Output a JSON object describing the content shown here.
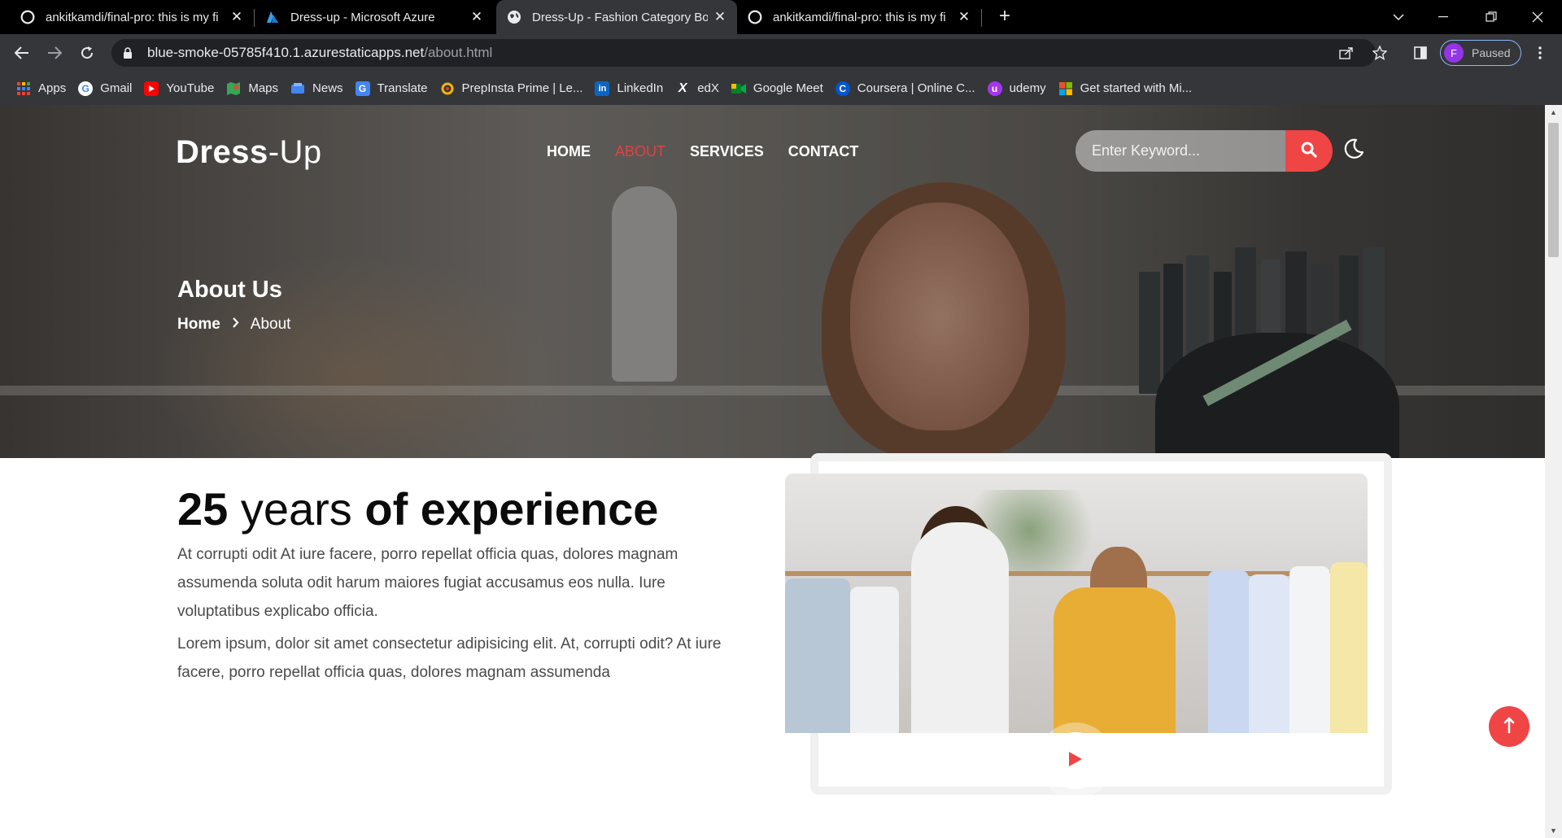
{
  "browser": {
    "tabs": [
      {
        "title": "ankitkamdi/final-pro: this is my fi",
        "active": false
      },
      {
        "title": "Dress-up - Microsoft Azure",
        "active": false
      },
      {
        "title": "Dress-Up - Fashion Category Boo",
        "active": true
      },
      {
        "title": "ankitkamdi/final-pro: this is my fi",
        "active": false
      }
    ],
    "url_host": "blue-smoke-05785f410.1.azurestaticapps.net",
    "url_path": "/about.html",
    "profile_initial": "F",
    "profile_status": "Paused",
    "bookmarks": [
      {
        "label": "Apps",
        "icon": "apps-grid-icon"
      },
      {
        "label": "Gmail",
        "icon": "google-icon"
      },
      {
        "label": "YouTube",
        "icon": "youtube-icon"
      },
      {
        "label": "Maps",
        "icon": "maps-icon"
      },
      {
        "label": "News",
        "icon": "news-icon"
      },
      {
        "label": "Translate",
        "icon": "translate-icon"
      },
      {
        "label": "PrepInsta Prime | Le...",
        "icon": "prepinsta-icon"
      },
      {
        "label": "LinkedIn",
        "icon": "linkedin-icon"
      },
      {
        "label": "edX",
        "icon": "edx-icon"
      },
      {
        "label": "Google Meet",
        "icon": "meet-icon"
      },
      {
        "label": "Coursera | Online C...",
        "icon": "coursera-icon"
      },
      {
        "label": "udemy",
        "icon": "udemy-icon"
      },
      {
        "label": "Get started with Mi...",
        "icon": "microsoft-icon"
      }
    ]
  },
  "site": {
    "brand_bold": "Dress",
    "brand_light": "-Up",
    "nav": [
      {
        "label": "HOME",
        "active": false
      },
      {
        "label": "ABOUT",
        "active": true
      },
      {
        "label": "SERVICES",
        "active": false
      },
      {
        "label": "CONTACT",
        "active": false
      }
    ],
    "search_placeholder": "Enter Keyword...",
    "page_title": "About Us",
    "breadcrumb_home": "Home",
    "breadcrumb_current": "About",
    "about": {
      "heading_num": "25",
      "heading_light": " years ",
      "heading_bold": "of experience",
      "paragraph1": "At corrupti odit At iure facere, porro repellat officia quas, dolores magnam assumenda soluta odit harum maiores fugiat accusamus eos nulla. Iure voluptatibus explicabo officia.",
      "paragraph2": "Lorem ipsum, dolor sit amet consectetur adipisicing elit. At, corrupti odit? At iure facere, porro repellat officia quas, dolores magnam assumenda"
    }
  },
  "colors": {
    "accent": "#f04545",
    "nav_active": "#e24145",
    "chrome_dark": "#202124",
    "chrome_toolbar": "#35363a"
  }
}
